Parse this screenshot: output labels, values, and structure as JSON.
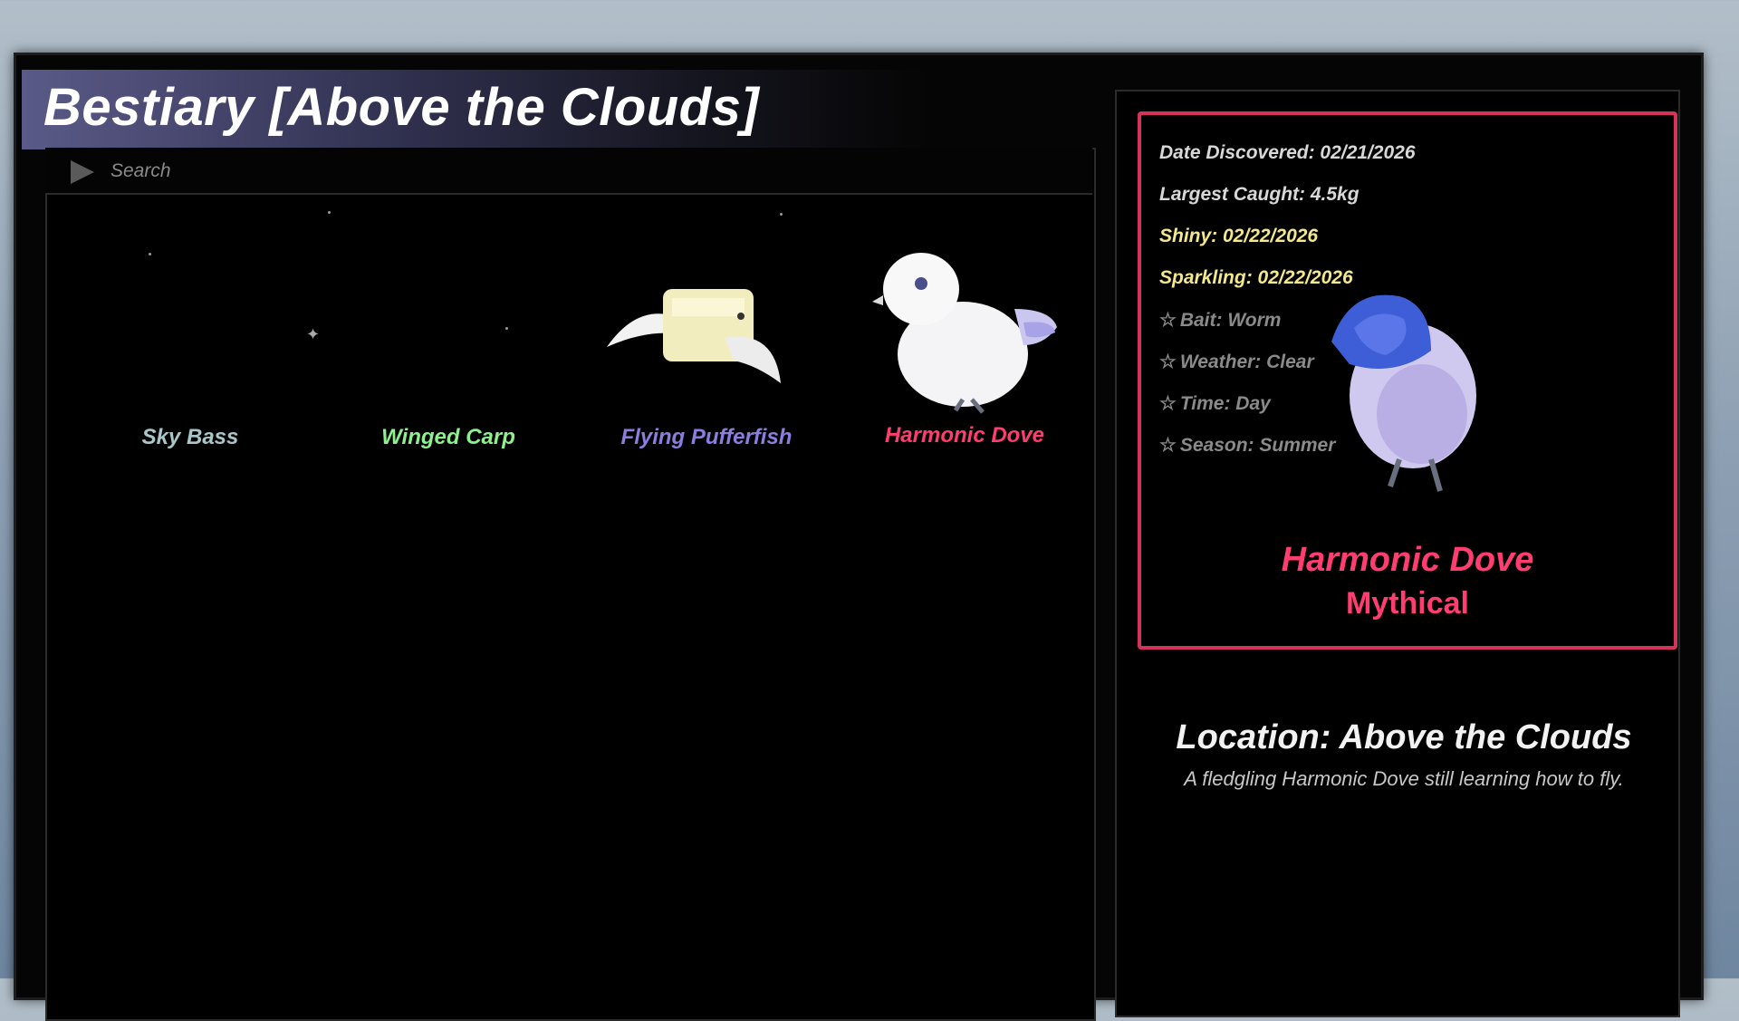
{
  "window": {
    "title": "Bestiary [Above the Clouds]"
  },
  "search": {
    "placeholder": "Search"
  },
  "fish_list": [
    {
      "name": "Sky Bass",
      "color": "#a9c7c9",
      "icon": "sky-bass-icon"
    },
    {
      "name": "Winged Carp",
      "color": "#8ff08f",
      "icon": "winged-carp-icon"
    },
    {
      "name": "Flying Pufferfish",
      "color": "#8a7ee0",
      "icon": "flying-pufferfish-icon"
    },
    {
      "name": "Harmonic Dove",
      "color": "#ff3d6e",
      "icon": "harmonic-dove-icon"
    }
  ],
  "selected": {
    "date_discovered": "Date Discovered: 02/21/2026",
    "largest_caught": "Largest Caught: 4.5kg",
    "shiny": "Shiny: 02/22/2026",
    "sparkling": "Sparkling: 02/22/2026",
    "requirements": [
      "Bait: Worm",
      "Weather: Clear",
      "Time: Day",
      "Season: Summer"
    ],
    "name": "Harmonic Dove",
    "rarity": "Mythical",
    "rarity_color": "#ff3d6e",
    "location": "Location: Above the Clouds",
    "description": "A fledgling Harmonic Dove still learning how to fly."
  }
}
